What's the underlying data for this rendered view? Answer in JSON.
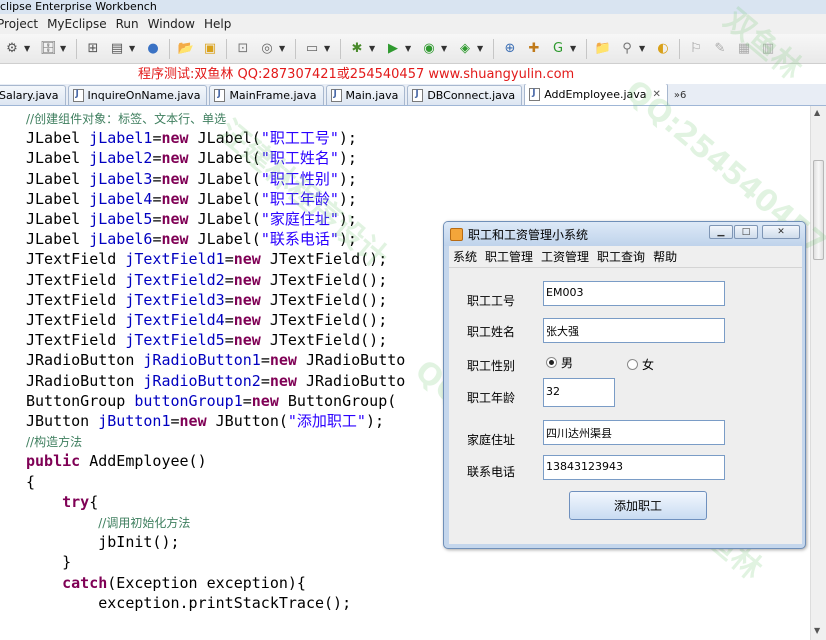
{
  "window": {
    "title": "clipse Enterprise Workbench"
  },
  "menu": [
    "Project",
    "MyEclipse",
    "Run",
    "Window",
    "Help"
  ],
  "banner": "程序测试:双鱼林 QQ:287307421或254540457 www.shuangyulin.com",
  "tabs": [
    {
      "label": "Salary.java",
      "active": false
    },
    {
      "label": "InquireOnName.java",
      "active": false
    },
    {
      "label": "MainFrame.java",
      "active": false
    },
    {
      "label": "Main.java",
      "active": false
    },
    {
      "label": "DBConnect.java",
      "active": false
    },
    {
      "label": "AddEmployee.java",
      "active": true
    }
  ],
  "tab_overflow": "»6",
  "code": [
    "//创建组件对象：标签、文本行、单选",
    "JLabel jLabel1=new JLabel(\"职工工号\");",
    "JLabel jLabel2=new JLabel(\"职工姓名\");",
    "JLabel jLabel3=new JLabel(\"职工性别\");",
    "JLabel jLabel4=new JLabel(\"职工年龄\");",
    "JLabel jLabel5=new JLabel(\"家庭住址\");",
    "JLabel jLabel6=new JLabel(\"联系电话\");",
    "JTextField jTextField1=new JTextField();",
    "JTextField jTextField2=new JTextField();",
    "JTextField jTextField3=new JTextField();",
    "JTextField jTextField4=new JTextField();",
    "JTextField jTextField5=new JTextField();",
    "JRadioButton jRadioButton1=new JRadioButto",
    "JRadioButton jRadioButton2=new JRadioButto",
    "ButtonGroup buttonGroup1=new ButtonGroup(",
    "JButton jButton1=new JButton(\"添加职工\");",
    "//构造方法",
    "public AddEmployee()",
    "{",
    "    try{",
    "        //调用初始化方法",
    "        jbInit();",
    "    }",
    "    catch(Exception exception){",
    "        exception.printStackTrace();"
  ],
  "dialog": {
    "title": "职工和工资管理小系统",
    "menu": [
      "系统",
      "职工管理",
      "工资管理",
      "职工查询",
      "帮助"
    ],
    "labels": {
      "id": "职工工号",
      "name": "职工姓名",
      "gender": "职工性别",
      "age": "职工年龄",
      "address": "家庭住址",
      "phone": "联系电话"
    },
    "values": {
      "id": "EM003",
      "name": "张大强",
      "age": "32",
      "address": "四川达州渠县",
      "phone": "13843123943"
    },
    "gender_options": [
      "男",
      "女"
    ],
    "gender_selected": "男",
    "submit": "添加职工"
  },
  "watermark": [
    "汪建林程序设计",
    "QQ:254540457",
    "双鱼林"
  ]
}
